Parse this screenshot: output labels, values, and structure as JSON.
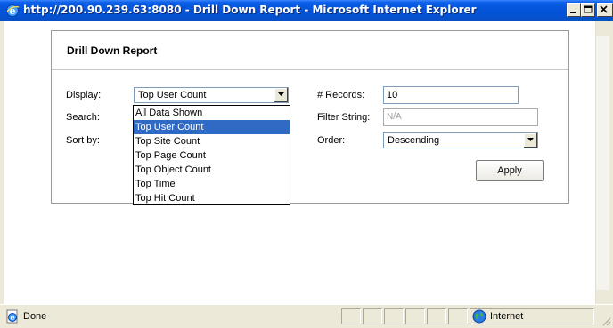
{
  "window": {
    "title": "http://200.90.239.63:8080 - Drill Down Report - Microsoft Internet Explorer",
    "title_icon": "ie-icon",
    "controls": [
      "minimize-icon",
      "maximize-icon",
      "close-icon"
    ]
  },
  "report": {
    "title": "Drill Down Report",
    "display_label": "Display:",
    "display_value": "Top User Count",
    "display_options": [
      "All Data Shown",
      "Top User Count",
      "Top Site Count",
      "Top Page Count",
      "Top Object Count",
      "Top Time",
      "Top Hit Count"
    ],
    "display_selected_index": 1,
    "search_label": "Search:",
    "sortby_label": "Sort by:",
    "records_label": "# Records:",
    "records_value": "10",
    "filter_label": "Filter String:",
    "filter_value": "N/A",
    "order_label": "Order:",
    "order_value": "Descending",
    "apply_label": "Apply"
  },
  "status": {
    "text": "Done",
    "zone": "Internet",
    "icons": [
      "ie-page-icon",
      "globe-icon",
      "resize-grip-icon"
    ]
  },
  "colors": {
    "titlebar": "#0553d9",
    "selection": "#316ac5",
    "chrome": "#ece9d8"
  }
}
